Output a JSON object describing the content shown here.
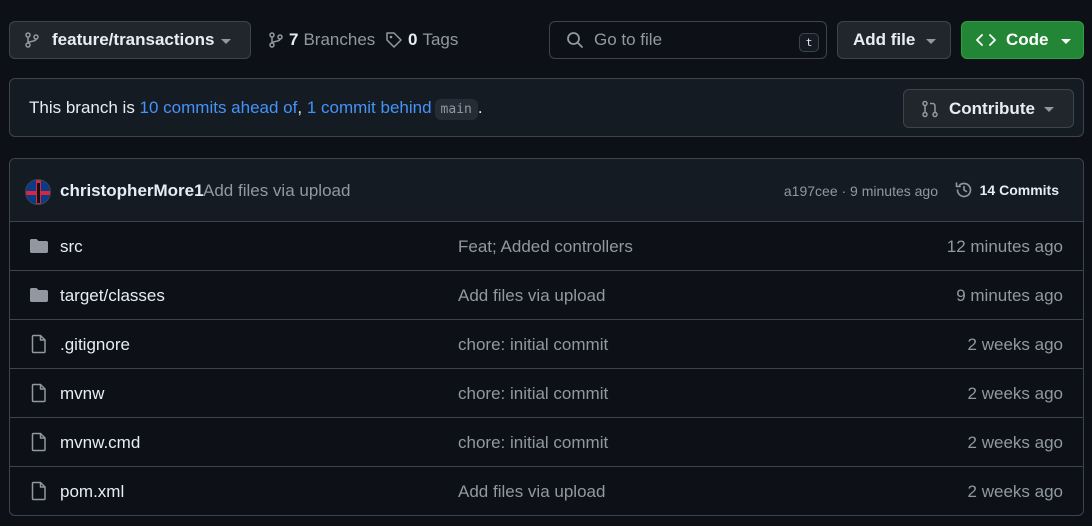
{
  "toolbar": {
    "branch_name": "feature/transactions",
    "branches_count": "7",
    "branches_label": "Branches",
    "tags_count": "0",
    "tags_label": "Tags",
    "search_placeholder": "Go to file",
    "search_shortcut": "t",
    "add_file_label": "Add file",
    "code_label": "Code"
  },
  "branch_status": {
    "prefix": "This branch is ",
    "ahead_text": "10 commits ahead of",
    "separator": ", ",
    "behind_text": "1 commit behind",
    "base_branch": "main",
    "suffix": ".",
    "contribute_label": "Contribute"
  },
  "latest_commit": {
    "author": "christopherMore1",
    "message": "Add files via upload",
    "hash_time": "a197cee · 9 minutes ago",
    "commits_count": "14 Commits"
  },
  "files": [
    {
      "type": "folder",
      "name": "src",
      "message": "Feat; Added controllers",
      "time": "12 minutes ago"
    },
    {
      "type": "folder",
      "name": "target/classes",
      "message": "Add files via upload",
      "time": "9 minutes ago"
    },
    {
      "type": "file",
      "name": ".gitignore",
      "message": "chore: initial commit",
      "time": "2 weeks ago"
    },
    {
      "type": "file",
      "name": "mvnw",
      "message": "chore: initial commit",
      "time": "2 weeks ago"
    },
    {
      "type": "file",
      "name": "mvnw.cmd",
      "message": "chore: initial commit",
      "time": "2 weeks ago"
    },
    {
      "type": "file",
      "name": "pom.xml",
      "message": "Add files via upload",
      "time": "2 weeks ago"
    }
  ],
  "colors": {
    "background": "#0d1117",
    "accent_green": "#238636",
    "link_blue": "#4493f8"
  }
}
